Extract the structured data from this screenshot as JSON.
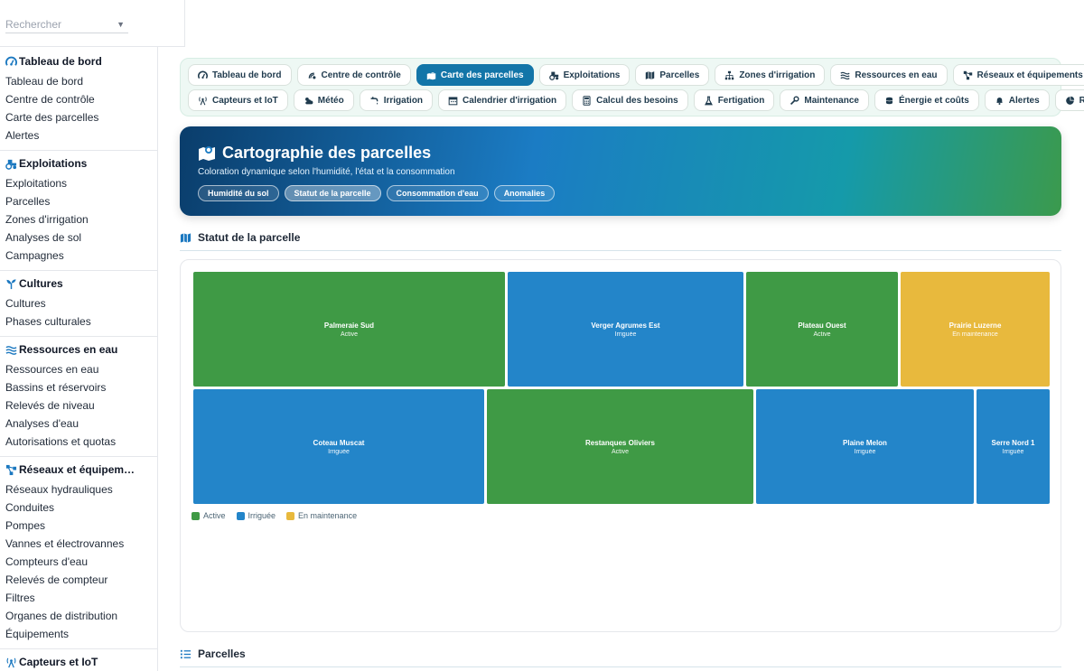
{
  "search": {
    "placeholder": "Rechercher"
  },
  "sidebar": {
    "groups": [
      {
        "title": "Tableau de bord",
        "icon": "gauge-icon",
        "items": [
          "Tableau de bord",
          "Centre de contrôle",
          "Carte des parcelles",
          "Alertes"
        ]
      },
      {
        "title": "Exploitations",
        "icon": "tractor-icon",
        "items": [
          "Exploitations",
          "Parcelles",
          "Zones d'irrigation",
          "Analyses de sol",
          "Campagnes"
        ]
      },
      {
        "title": "Cultures",
        "icon": "seedling-icon",
        "items": [
          "Cultures",
          "Phases culturales"
        ]
      },
      {
        "title": "Ressources en eau",
        "icon": "water-icon",
        "items": [
          "Ressources en eau",
          "Bassins et réservoirs",
          "Relevés de niveau",
          "Analyses d'eau",
          "Autorisations et quotas"
        ]
      },
      {
        "title": "Réseaux et équipem…",
        "icon": "network-icon",
        "items": [
          "Réseaux hydrauliques",
          "Conduites",
          "Pompes",
          "Vannes et électrovannes",
          "Compteurs d'eau",
          "Relevés de compteur",
          "Filtres",
          "Organes de distribution",
          "Équipements"
        ]
      },
      {
        "title": "Capteurs et IoT",
        "icon": "antenna-icon",
        "items": []
      }
    ]
  },
  "tabs": {
    "row1": [
      {
        "label": "Tableau de bord",
        "icon": "gauge-icon"
      },
      {
        "label": "Centre de contrôle",
        "icon": "satellite-icon"
      },
      {
        "label": "Carte des parcelles",
        "icon": "map-marked-icon",
        "active": true
      },
      {
        "label": "Exploitations",
        "icon": "tractor-icon"
      },
      {
        "label": "Parcelles",
        "icon": "map-icon"
      },
      {
        "label": "Zones d'irrigation",
        "icon": "sitemap-icon"
      },
      {
        "label": "Ressources en eau",
        "icon": "water-icon"
      },
      {
        "label": "Réseaux et équipements",
        "icon": "network-icon"
      }
    ],
    "row2": [
      {
        "label": "Capteurs et IoT",
        "icon": "antenna-icon"
      },
      {
        "label": "Météo",
        "icon": "cloud-sun-icon"
      },
      {
        "label": "Irrigation",
        "icon": "faucet-icon"
      },
      {
        "label": "Calendrier d'irrigation",
        "icon": "calendar-icon"
      },
      {
        "label": "Calcul des besoins",
        "icon": "calculator-icon"
      },
      {
        "label": "Fertigation",
        "icon": "flask-icon"
      },
      {
        "label": "Maintenance",
        "icon": "wrench-icon"
      },
      {
        "label": "Énergie et coûts",
        "icon": "coins-icon"
      },
      {
        "label": "Alertes",
        "icon": "bell-icon"
      },
      {
        "label": "Reporting",
        "icon": "chart-pie-icon"
      }
    ]
  },
  "hero": {
    "title": "Cartographie des parcelles",
    "subtitle": "Coloration dynamique selon l'humidité, l'état et la consommation",
    "pills": [
      {
        "label": "Humidité du sol"
      },
      {
        "label": "Statut de la parcelle",
        "active": true
      },
      {
        "label": "Consommation d'eau"
      },
      {
        "label": "Anomalies"
      }
    ]
  },
  "map_section": {
    "title": "Statut de la parcelle"
  },
  "parcels_section": {
    "title": "Parcelles"
  },
  "colors": {
    "active": "#3f9a45",
    "irrigated": "#2385c9",
    "maintenance": "#e8b93d"
  },
  "treemap": {
    "rows": [
      [
        {
          "name": "Palmeraie Sud",
          "status": "Active",
          "weight": 344
        },
        {
          "name": "Verger Agrumes Est",
          "status": "Irriguée",
          "weight": 260
        },
        {
          "name": "Plateau Ouest",
          "status": "Active",
          "weight": 168
        },
        {
          "name": "Prairie Luzerne",
          "status": "En maintenance",
          "weight": 165
        }
      ],
      [
        {
          "name": "Coteau Muscat",
          "status": "Irriguée",
          "weight": 322
        },
        {
          "name": "Restanques Oliviers",
          "status": "Active",
          "weight": 295
        },
        {
          "name": "Plaine Melon",
          "status": "Irriguée",
          "weight": 241
        },
        {
          "name": "Serre Nord 1",
          "status": "Irriguée",
          "weight": 81
        }
      ]
    ]
  },
  "legend": [
    {
      "label": "Active",
      "status": "Active"
    },
    {
      "label": "Irriguée",
      "status": "Irriguée"
    },
    {
      "label": "En maintenance",
      "status": "En maintenance"
    }
  ]
}
